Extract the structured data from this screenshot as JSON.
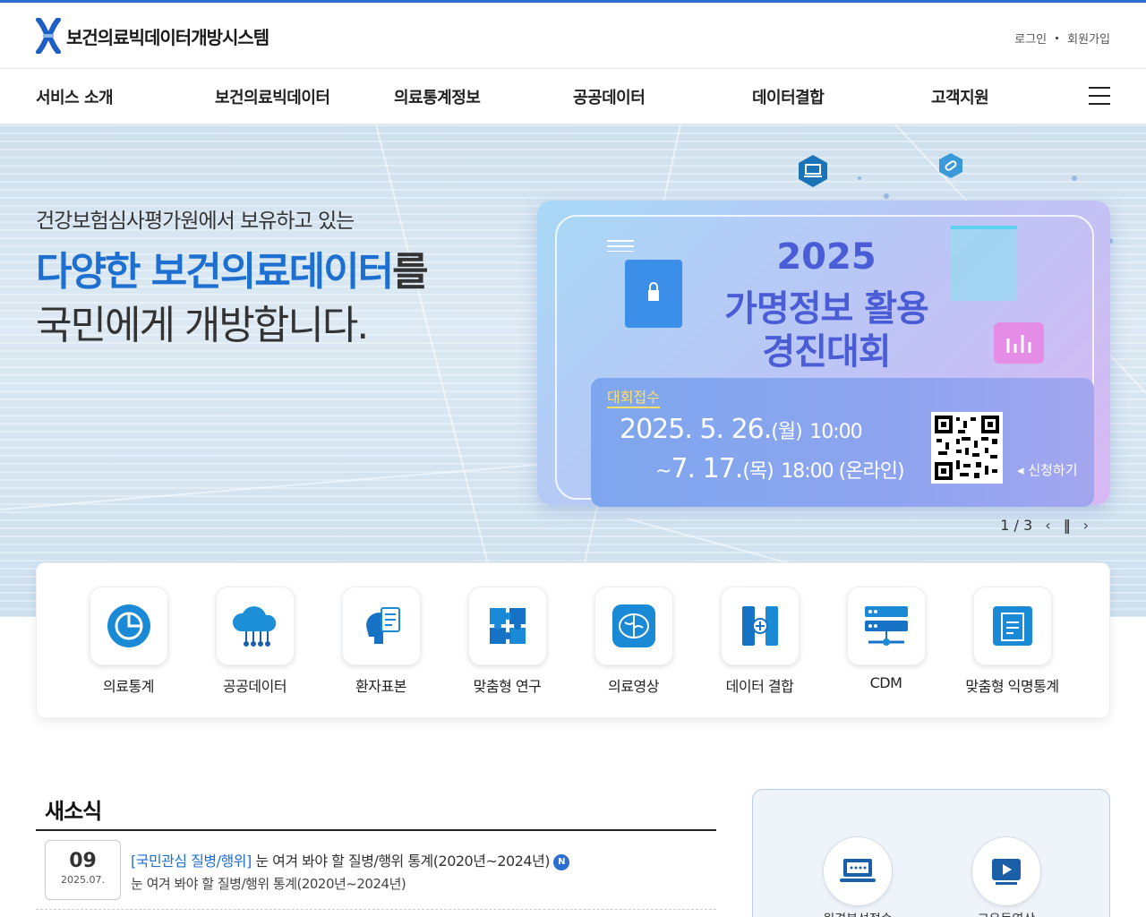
{
  "header": {
    "site_title": "보건의료빅데이터개방시스템",
    "login": "로그인",
    "signup": "회원가입"
  },
  "nav": {
    "items": [
      "서비스 소개",
      "보건의료빅데이터",
      "의료통계정보",
      "공공데이터",
      "데이터결합",
      "고객지원"
    ]
  },
  "hero": {
    "subtitle": "건강보험심사평가원에서 보유하고 있는",
    "title_accent": "다양한 보건의료데이터",
    "title_suffix": "를",
    "title_line2": "국민에게 개방합니다."
  },
  "banner": {
    "year": "2025",
    "title_line1": "가명정보 활용",
    "title_line2": "경진대회",
    "tag": "대회접수",
    "date_start_main": "2025. 5. 26.",
    "date_start_day": "(월)",
    "date_start_time": "10:00",
    "date_end_prefix": "~",
    "date_end_main": "7. 17.",
    "date_end_day": "(목)",
    "date_end_time": "18:00 (온라인)",
    "apply": "신청하기"
  },
  "slider": {
    "current": "1",
    "separator": "/",
    "total": "3"
  },
  "quick_menu": {
    "items": [
      "의료통계",
      "공공데이터",
      "환자표본",
      "맞춤형 연구",
      "의료영상",
      "데이터 결합",
      "CDM",
      "맞춤형 익명통계"
    ]
  },
  "news": {
    "title": "새소식",
    "items": [
      {
        "day": "09",
        "year_month": "2025.07.",
        "category": "[국민관심 질병/행위]",
        "headline": " 눈 여겨 봐야 할 질병/행위 통계(2020년~2024년)",
        "badge": "N",
        "description": "눈 여겨 봐야 할 질병/행위 통계(2020년~2024년)"
      }
    ]
  },
  "side_panel": {
    "items": [
      "원격분석접속",
      "고유동영상"
    ]
  },
  "colors": {
    "accent": "#1d6fd0",
    "banner_text": "#4a5cd6",
    "top_line": "#2b6fd1"
  }
}
